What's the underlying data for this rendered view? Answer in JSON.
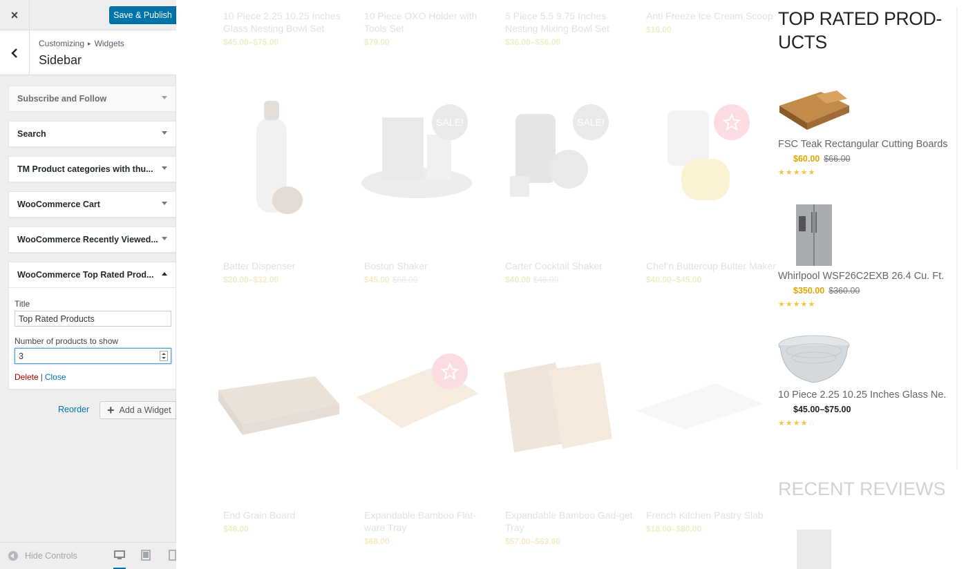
{
  "topbar": {
    "close_label": "×",
    "save_label": "Save & Publish"
  },
  "section": {
    "breadcrumb_parent": "Customizing",
    "breadcrumb_separator": "▸",
    "breadcrumb_child": "Widgets",
    "title": "Sidebar"
  },
  "widgets": [
    {
      "label": "Subscribe and Follow"
    },
    {
      "label": "Search"
    },
    {
      "label": "TM Product categories with thu..."
    },
    {
      "label": "WooCommerce Cart"
    },
    {
      "label": "WooCommerce Recently Viewed..."
    },
    {
      "label": "WooCommerce Top Rated Prod..."
    }
  ],
  "expanded_widget": {
    "title_label": "Title",
    "title_value": "Top Rated Products",
    "number_label": "Number of products to show",
    "number_value": "3",
    "delete_label": "Delete",
    "separator": "|",
    "close_label": "Close"
  },
  "actions": {
    "reorder_label": "Reorder",
    "add_widget_label": "Add a Widget",
    "add_widget_icon": "plus-icon"
  },
  "footer": {
    "hide_controls_label": "Hide Controls",
    "devices": [
      "desktop-icon",
      "tablet-icon",
      "mobile-icon"
    ]
  },
  "colors": {
    "primary_button": "#0073aa",
    "delete": "#aa0000",
    "price_gold": "#e0a500",
    "badge_pink": "#f06a7d"
  },
  "preview": {
    "product_rows": [
      [
        {
          "name": "10 Piece 2.25 10.25 Inches Glass Nesting Bowl Set",
          "price": "$45.00–$75.00",
          "old": ""
        },
        {
          "name": "10 Piece OXO Holder with Tools Set",
          "price": "$79.00",
          "old": ""
        },
        {
          "name": "5 Piece 5.5 9.75 Inches Nesting Mixing Bowl Set",
          "price": "$36.00–$56.00",
          "old": ""
        },
        {
          "name": "Anti Freeze Ice Cream Scoop",
          "price": "$16.00",
          "old": ""
        }
      ],
      [
        {
          "name": "Batter Dispenser",
          "price": "$20.00–$32.00",
          "old": ""
        },
        {
          "name": "Boston Shaker",
          "price": "$45.00",
          "old": "$68.00"
        },
        {
          "name": "Carter Cocktail Shaker",
          "price": "$40.00",
          "old": "$46.00"
        },
        {
          "name": "Chef'n Buttercup Butter Maker",
          "price": "$40.00–$45.00",
          "old": ""
        }
      ],
      [
        {
          "name": "End Grain Board",
          "price": "$48.00",
          "old": ""
        },
        {
          "name": "Expandable Bamboo Flat-ware Tray",
          "price": "$68.00",
          "old": ""
        },
        {
          "name": "Expandable Bamboo Gad-get Tray",
          "price": "$57.00–$63.00",
          "old": ""
        },
        {
          "name": "French Kitchen Pastry Slab",
          "price": "$18.00–$80.00",
          "old": ""
        }
      ]
    ],
    "sale_label": "SALE!",
    "top_rated": {
      "title": "TOP RATED PROD-UCTS",
      "items": [
        {
          "name": "FSC Teak Rectangular Cutting Boards...",
          "price": "$60.00",
          "old": "$66.00",
          "rating": 5
        },
        {
          "name": "Whirlpool WSF26C2EXB 26.4 Cu. Ft. ...",
          "price": "$350.00",
          "old": "$360.00",
          "rating": 5
        },
        {
          "name": "10 Piece 2.25 10.25 Inches Glass Ne...",
          "price": "$45.00–$75.00",
          "old": "",
          "rating": 4
        }
      ]
    },
    "recent_reviews_title": "RECENT REVIEWS"
  }
}
